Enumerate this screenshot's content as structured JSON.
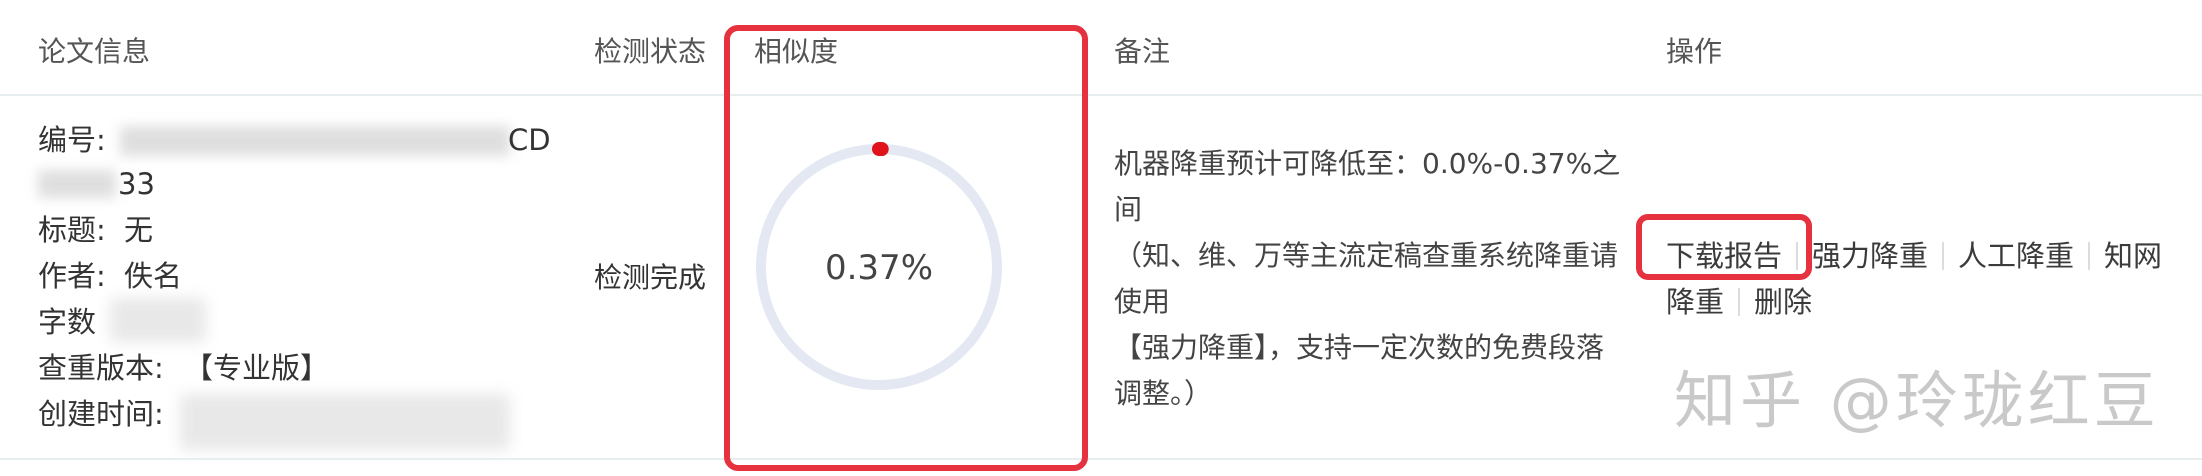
{
  "header": {
    "col_info": "论文信息",
    "col_status": "检测状态",
    "col_similarity": "相似度",
    "col_note": "备注",
    "col_ops": "操作"
  },
  "row": {
    "id_label": "编号:",
    "id_value_tail": "CD",
    "id_value_line2_tail": "33",
    "title_label": "标题:",
    "title_value": "无",
    "author_label": "作者:",
    "author_value": "佚名",
    "word_count_label": "字数",
    "version_label": "查重版本:",
    "version_value": "【专业版】",
    "created_label": "创建时间:",
    "status": "检测完成",
    "similarity": {
      "value_text": "0.37%",
      "fraction": 0.0037,
      "track_color": "#e3e8f3",
      "progress_color": "#e0131d"
    },
    "note_lines": [
      "机器降重预计可降低至：0.0%-0.37%之",
      "间",
      "（知、维、万等主流定稿查重系统降重请",
      "使用",
      "【强力降重】，支持一定次数的免费段落",
      "调整。）"
    ],
    "actions": {
      "download": "下载报告",
      "strong_reduce": "强力降重",
      "manual_reduce": "人工降重",
      "zhiwang_reduce_1": "知网",
      "zhiwang_reduce_2": "降重",
      "delete": "删除"
    }
  },
  "highlight_color": "#e5323e",
  "watermark": "知乎 @玲珑红豆"
}
